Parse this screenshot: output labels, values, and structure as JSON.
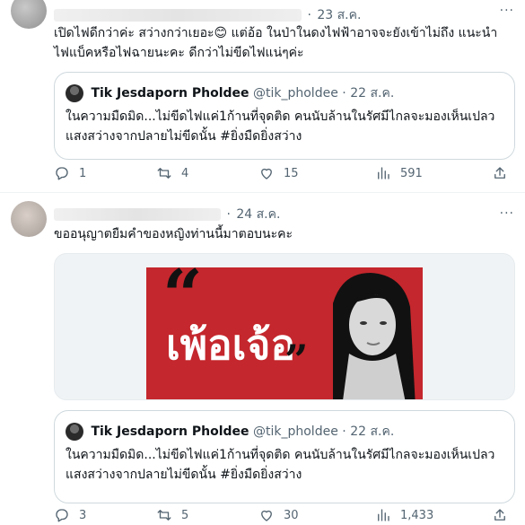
{
  "tweets": [
    {
      "time": "23 ส.ค.",
      "text_line1": "เปิดไฟดีกว่าค่ะ สว่างกว่าเยอะ😊 แต่อ้อ ในป่าในดงไฟฟ้าอาจจะยังเข้าไม่ถึง แนะนำ",
      "text_line2": "ไฟแบ็คหรือไฟฉายนะคะ ดีกว่าไม่ขีดไฟแน่ๆค่ะ",
      "quote": {
        "name": "Tik Jesdaporn Pholdee",
        "handle": "@tik_pholdee",
        "time": "22 ส.ค.",
        "text_line1": "ในความมืดมิด...ไม่ขีดไฟแค่1ก้านที่จุดติด คนนับล้านในรัศมีไกลจะมองเห็นเปลว",
        "text_line2": "แสงสว่างจากปลายไม่ขีดนั้น #ยิ่งมืดยิ่งสว่าง"
      },
      "stats": {
        "replies": "1",
        "retweets": "4",
        "likes": "15",
        "views": "591"
      }
    },
    {
      "time": "24 ส.ค.",
      "text_line1": "ขออนุญาตยืมคำของหญิงท่านนี้มาตอบนะคะ",
      "media": {
        "quote_open": "“",
        "word": "เพ้อเจ้อ",
        "quote_close": "”"
      },
      "quote": {
        "name": "Tik Jesdaporn Pholdee",
        "handle": "@tik_pholdee",
        "time": "22 ส.ค.",
        "text_line1": "ในความมืดมิด...ไม่ขีดไฟแค่1ก้านที่จุดติด คนนับล้านในรัศมีไกลจะมองเห็นเปลว",
        "text_line2": "แสงสว่างจากปลายไม่ขีดนั้น #ยิ่งมืดยิ่งสว่าง"
      },
      "stats": {
        "replies": "3",
        "retweets": "5",
        "likes": "30",
        "views": "1,433"
      }
    }
  ],
  "ui": {
    "separator": "·",
    "more": "···"
  },
  "icons": {
    "reply": "reply-icon",
    "retweet": "retweet-icon",
    "like": "heart-icon",
    "views": "views-icon",
    "share": "share-icon"
  },
  "colors": {
    "text": "#0f1419",
    "muted": "#536471",
    "border": "#cfd9de",
    "poster_red": "#c4272d"
  }
}
